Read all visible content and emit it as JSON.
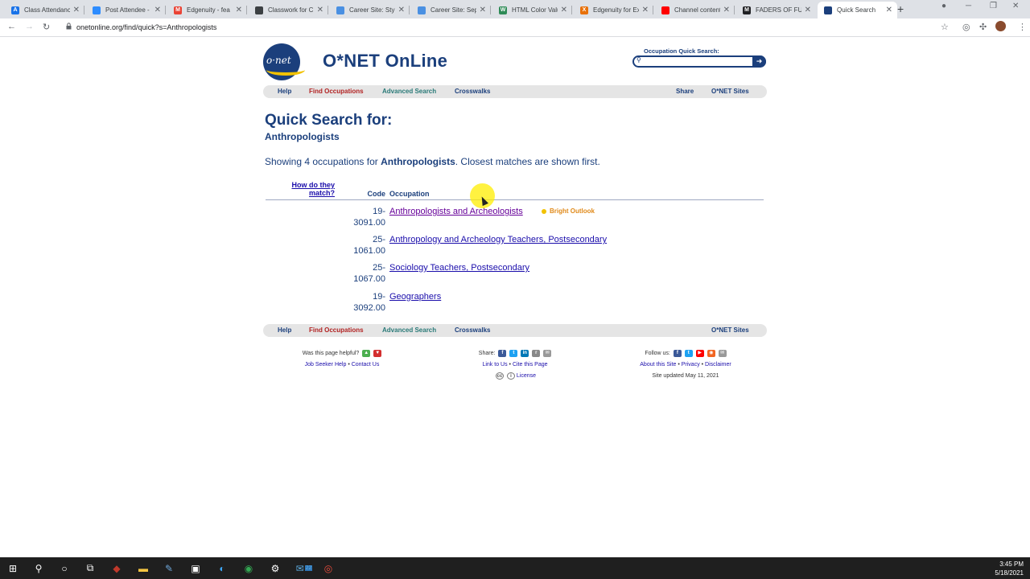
{
  "browser": {
    "tabs": [
      {
        "title": "Class Attendance",
        "fav_color": "#1a73e8",
        "fav_letter": "A"
      },
      {
        "title": "Post Attendee -",
        "fav_color": "#2d8cff",
        "fav_letter": ""
      },
      {
        "title": "Edgenuity - fea",
        "fav_color": "#ea4335",
        "fav_letter": "M"
      },
      {
        "title": "Classwork for Cl",
        "fav_color": "#3c4043",
        "fav_letter": ""
      },
      {
        "title": "Career Site: Styl",
        "fav_color": "#4a90e2",
        "fav_letter": ""
      },
      {
        "title": "Career Site: Sep",
        "fav_color": "#4a90e2",
        "fav_letter": ""
      },
      {
        "title": "HTML Color Valu",
        "fav_color": "#2e8b57",
        "fav_letter": "W"
      },
      {
        "title": "Edgenuity for Ex",
        "fav_color": "#e8710a",
        "fav_letter": "X"
      },
      {
        "title": "Channel content",
        "fav_color": "#ff0000",
        "fav_letter": ""
      },
      {
        "title": "FADERS OF FUR",
        "fav_color": "#202124",
        "fav_letter": "M"
      },
      {
        "title": "Quick Search",
        "fav_color": "#1b3f7c",
        "fav_letter": ""
      }
    ],
    "url": "onetonline.org/find/quick?s=Anthropologists"
  },
  "site": {
    "title": "O*NET OnLine",
    "logo_text": "o·net",
    "quick_search_label": "Occupation Quick Search:",
    "quick_search_value": ""
  },
  "nav": {
    "help": "Help",
    "find": "Find Occupations",
    "advanced": "Advanced Search",
    "crosswalks": "Crosswalks",
    "share": "Share",
    "sites": "O*NET Sites"
  },
  "main": {
    "heading": "Quick Search for:",
    "query": "Anthropologists",
    "showing_prefix": "Showing 4 occupations for ",
    "showing_term": "Anthropologists",
    "showing_suffix": ". Closest matches are shown first.",
    "col_how": "How do they match?",
    "col_code": "Code",
    "col_occupation": "Occupation",
    "rows": [
      {
        "code_a": "19-",
        "code_b": "3091.00",
        "title": "Anthropologists and Archeologists",
        "badge": "Bright Outlook"
      },
      {
        "code_a": "25-",
        "code_b": "1061.00",
        "title": "Anthropology and Archeology Teachers, Postsecondary",
        "badge": ""
      },
      {
        "code_a": "25-",
        "code_b": "1067.00",
        "title": "Sociology Teachers, Postsecondary",
        "badge": ""
      },
      {
        "code_a": "19-",
        "code_b": "3092.00",
        "title": "Geographers",
        "badge": ""
      }
    ]
  },
  "footer": {
    "helpful": "Was this page helpful?",
    "job_seeker_help": "Job Seeker Help",
    "contact": "Contact Us",
    "share": "Share:",
    "link_to_us": "Link to Us",
    "cite": "Cite this Page",
    "license": "License",
    "follow": "Follow us:",
    "about": "About this Site",
    "privacy": "Privacy",
    "disclaimer": "Disclaimer",
    "updated": "Site updated May 11, 2021"
  },
  "taskbar": {
    "time": "3:45 PM",
    "date": "5/18/2021",
    "mail_badge": "22"
  }
}
